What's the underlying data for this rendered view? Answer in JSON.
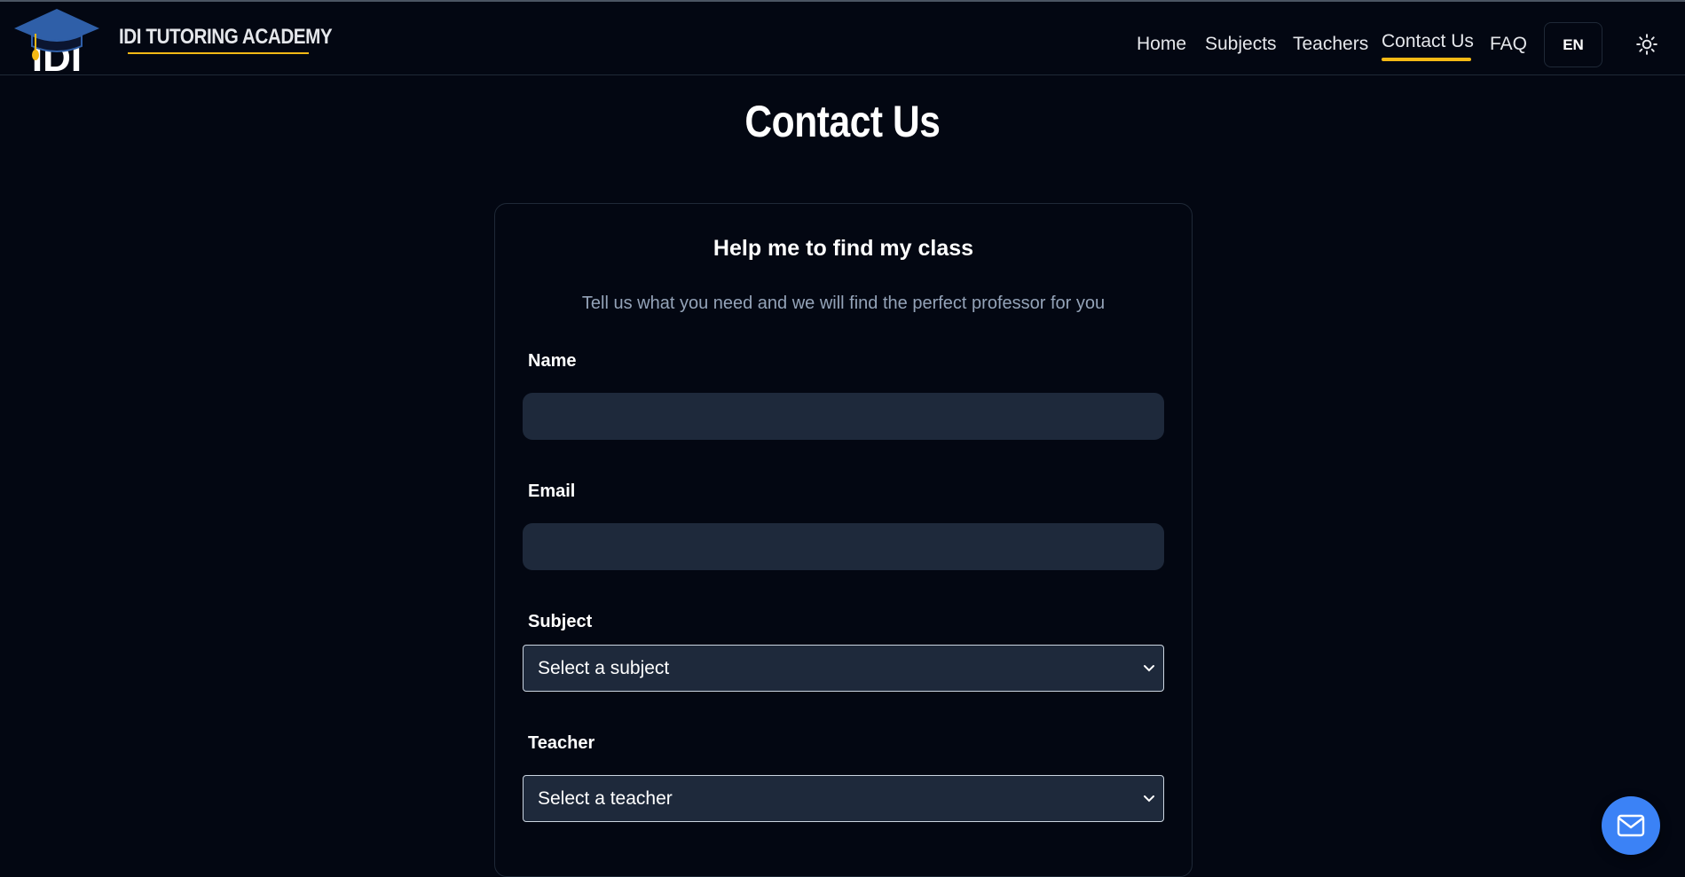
{
  "header": {
    "logo_text": "IDI",
    "brand": "IDI TUTORING ACADEMY",
    "nav": [
      {
        "label": "Home"
      },
      {
        "label": "Subjects"
      },
      {
        "label": "Teachers"
      },
      {
        "label": "Contact Us",
        "active": true
      },
      {
        "label": "FAQ"
      }
    ],
    "language": "EN",
    "theme_icon": "sun-icon"
  },
  "page": {
    "title": "Contact Us"
  },
  "form": {
    "title": "Help me to find my class",
    "subtitle": "Tell us what you need and we will find the perfect professor for you",
    "name_label": "Name",
    "name_value": "",
    "email_label": "Email",
    "email_value": "",
    "subject_label": "Subject",
    "subject_selected": "Select a subject",
    "teacher_label": "Teacher",
    "teacher_selected": "Select a teacher"
  },
  "fab": {
    "icon": "mail-icon"
  },
  "colors": {
    "background": "#030712",
    "accent": "#f5b915",
    "input_bg": "#1e293b",
    "fab": "#3b82f6",
    "logo_cap": "#2f5fa8"
  }
}
